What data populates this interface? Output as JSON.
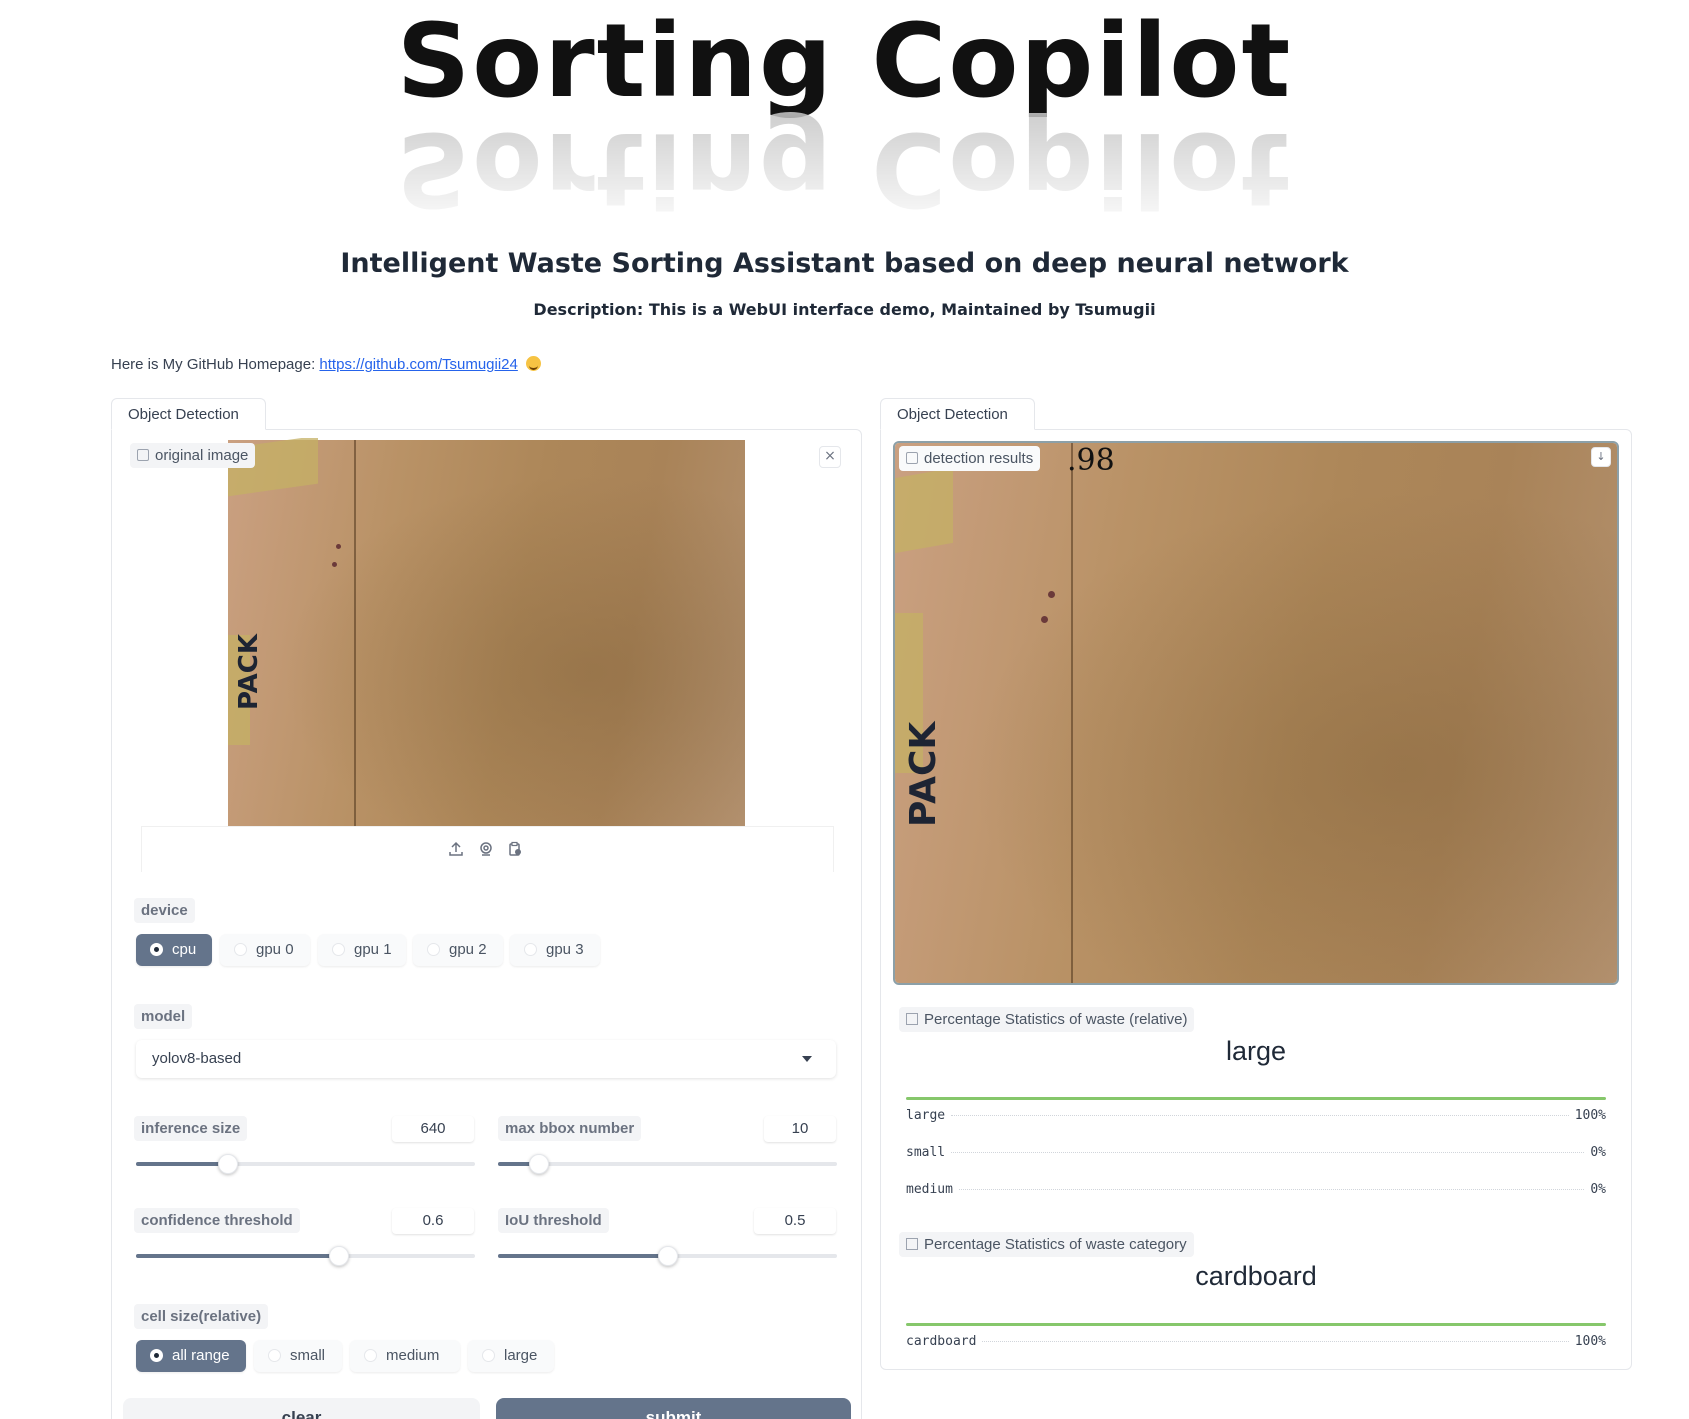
{
  "header": {
    "logo_text": "Sorting Copilot",
    "subtitle": "Intelligent Waste Sorting Assistant based on deep neural network",
    "description": "Description: This is a WebUI interface demo, Maintained by Tsumugii"
  },
  "github": {
    "prefix": "Here is My GitHub Homepage: ",
    "link_text": "https://github.com/Tsumugii24",
    "emoji": "smiling-face-emoji"
  },
  "left_panel": {
    "tab_label": "Object Detection",
    "image_label": "original image",
    "image_overlay_text": "PACK",
    "close_icon": "×",
    "toolbar_icons": [
      "upload-icon",
      "webcam-icon",
      "clipboard-icon"
    ],
    "device": {
      "label": "device",
      "options": [
        "cpu",
        "gpu 0",
        "gpu 1",
        "gpu 2",
        "gpu 3"
      ],
      "selected": "cpu"
    },
    "model": {
      "label": "model",
      "value": "yolov8-based"
    },
    "inference_size": {
      "label": "inference size",
      "value": "640",
      "fraction": 0.27
    },
    "max_bbox": {
      "label": "max bbox number",
      "value": "10",
      "fraction": 0.12
    },
    "confidence": {
      "label": "confidence threshold",
      "value": "0.6",
      "fraction": 0.6
    },
    "iou": {
      "label": "IoU threshold",
      "value": "0.5",
      "fraction": 0.5
    },
    "cell_size": {
      "label": "cell size(relative)",
      "options": [
        "all range",
        "small",
        "medium",
        "large"
      ],
      "selected": "all range"
    },
    "buttons": {
      "clear": "clear",
      "submit": "submit"
    }
  },
  "right_panel": {
    "tab_label": "Object Detection",
    "image_label": "detection results",
    "confidence_overlay": ".98",
    "image_overlay_text": "PACK",
    "download_icon": "download-icon",
    "size_stats": {
      "label": "Percentage Statistics of waste (relative)",
      "top": "large",
      "rows": [
        {
          "name": "large",
          "value": "100%"
        },
        {
          "name": "small",
          "value": "0%"
        },
        {
          "name": "medium",
          "value": "0%"
        }
      ]
    },
    "category_stats": {
      "label": "Percentage Statistics of waste category",
      "top": "cardboard",
      "rows": [
        {
          "name": "cardboard",
          "value": "100%"
        }
      ]
    }
  },
  "colors": {
    "accent": "#64748b",
    "link": "#2563eb",
    "stat_bar": "#86c76b"
  }
}
